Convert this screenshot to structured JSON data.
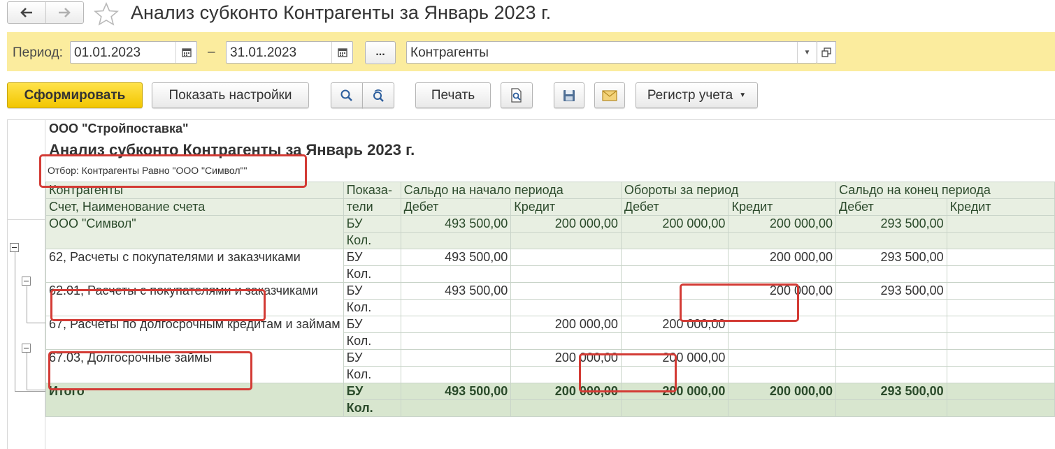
{
  "window": {
    "title": "Анализ субконто Контрагенты за Январь 2023 г.",
    "back_icon": "arrow-left-icon",
    "forward_icon": "arrow-right-icon",
    "favorite_icon": "star-icon"
  },
  "period": {
    "label": "Период:",
    "from": "01.01.2023",
    "dash": "–",
    "to": "31.01.2023",
    "ellipsis": "...",
    "subconto": "Контрагенты"
  },
  "toolbar": {
    "generate": "Сформировать",
    "show_settings": "Показать настройки",
    "print": "Печать",
    "register": "Регистр учета"
  },
  "report": {
    "organization": "ООО \"Стройпоставка\"",
    "title": "Анализ субконто Контрагенты за Январь 2023 г.",
    "filter": "Отбор: Контрагенты Равно \"ООО \"Символ\"\"",
    "headers": {
      "counterparties": "Контрагенты",
      "account": "Счет, Наименование счета",
      "indicators_1": "Показа-",
      "indicators_2": "тели",
      "opening": "Сальдо на начало периода",
      "turnover": "Обороты за период",
      "closing": "Сальдо на конец периода",
      "debit": "Дебет",
      "credit": "Кредит"
    },
    "rows": [
      {
        "name": "ООО \"Символ\"",
        "ind1": "БУ",
        "ind2": "Кол.",
        "od": "493 500,00",
        "oc": "200 000,00",
        "td": "200 000,00",
        "tc": "200 000,00",
        "cd": "293 500,00",
        "cc": ""
      },
      {
        "name": "62, Расчеты с покупателями и заказчиками",
        "ind1": "БУ",
        "ind2": "Кол.",
        "od": "493 500,00",
        "oc": "",
        "td": "",
        "tc": "200 000,00",
        "cd": "293 500,00",
        "cc": ""
      },
      {
        "name": "62.01, Расчеты с покупателями и заказчиками",
        "ind1": "БУ",
        "ind2": "Кол.",
        "od": "493 500,00",
        "oc": "",
        "td": "",
        "tc": "200 000,00",
        "cd": "293 500,00",
        "cc": ""
      },
      {
        "name": "67, Расчеты по долгосрочным кредитам и займам",
        "ind1": "БУ",
        "ind2": "Кол.",
        "od": "",
        "oc": "200 000,00",
        "td": "200 000,00",
        "tc": "",
        "cd": "",
        "cc": ""
      },
      {
        "name": "67.03, Долгосрочные займы",
        "ind1": "БУ",
        "ind2": "Кол.",
        "od": "",
        "oc": "200 000,00",
        "td": "200 000,00",
        "tc": "",
        "cd": "",
        "cc": ""
      }
    ],
    "total": {
      "name": "Итого",
      "ind1": "БУ",
      "ind2": "Кол.",
      "od": "493 500,00",
      "oc": "200 000,00",
      "td": "200 000,00",
      "tc": "200 000,00",
      "cd": "293 500,00",
      "cc": ""
    }
  },
  "colors": {
    "period_bar": "#fbec9e",
    "primary_button": "#f2c600",
    "annotation": "#d33b35",
    "group_row": "#e8efe2"
  }
}
